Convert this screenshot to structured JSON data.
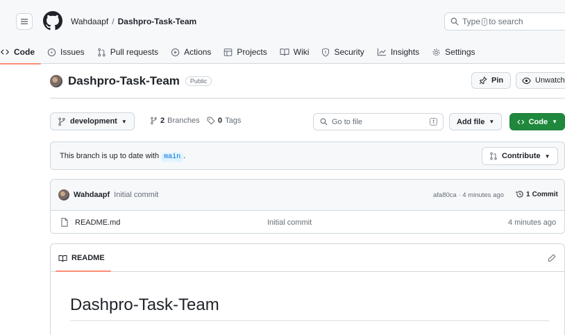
{
  "header": {
    "owner": "Wahdaapf",
    "separator": "/",
    "repo": "Dashpro-Task-Team",
    "search": {
      "prefix": "Type",
      "key": "/",
      "suffix": "to search"
    }
  },
  "tabs": [
    {
      "label": "Code",
      "icon": "code-icon"
    },
    {
      "label": "Issues",
      "icon": "issue-opened-icon"
    },
    {
      "label": "Pull requests",
      "icon": "git-pull-request-icon"
    },
    {
      "label": "Actions",
      "icon": "play-icon"
    },
    {
      "label": "Projects",
      "icon": "table-icon"
    },
    {
      "label": "Wiki",
      "icon": "book-icon"
    },
    {
      "label": "Security",
      "icon": "shield-icon"
    },
    {
      "label": "Insights",
      "icon": "graph-icon"
    },
    {
      "label": "Settings",
      "icon": "gear-icon"
    }
  ],
  "repo_head": {
    "title": "Dashpro-Task-Team",
    "visibility": "Public",
    "pin_label": "Pin",
    "unwatch_label": "Unwatch"
  },
  "toolbar": {
    "branch": "development",
    "branches_count": "2",
    "branches_label": "Branches",
    "tags_count": "0",
    "tags_label": "Tags",
    "goto_placeholder": "Go to file",
    "goto_key": "t",
    "add_file_label": "Add file",
    "code_label": "Code"
  },
  "branch_status": {
    "text": "This branch is up to date with",
    "base": "main",
    "period": ".",
    "contribute_label": "Contribute"
  },
  "commit": {
    "author": "Wahdaapf",
    "message": "Initial commit",
    "meta": "afa80ca · 4 minutes ago",
    "commits_count": "1",
    "commits_label": "Commit"
  },
  "files": [
    {
      "name": "README.md",
      "message": "Initial commit",
      "age": "4 minutes ago"
    }
  ],
  "readme": {
    "tab_label": "README",
    "heading": "Dashpro-Task-Team"
  },
  "colors": {
    "accent_tab": "#fd8c73",
    "green_button": "#1f883d",
    "border": "#d0d7de",
    "muted_text": "#656d76"
  }
}
